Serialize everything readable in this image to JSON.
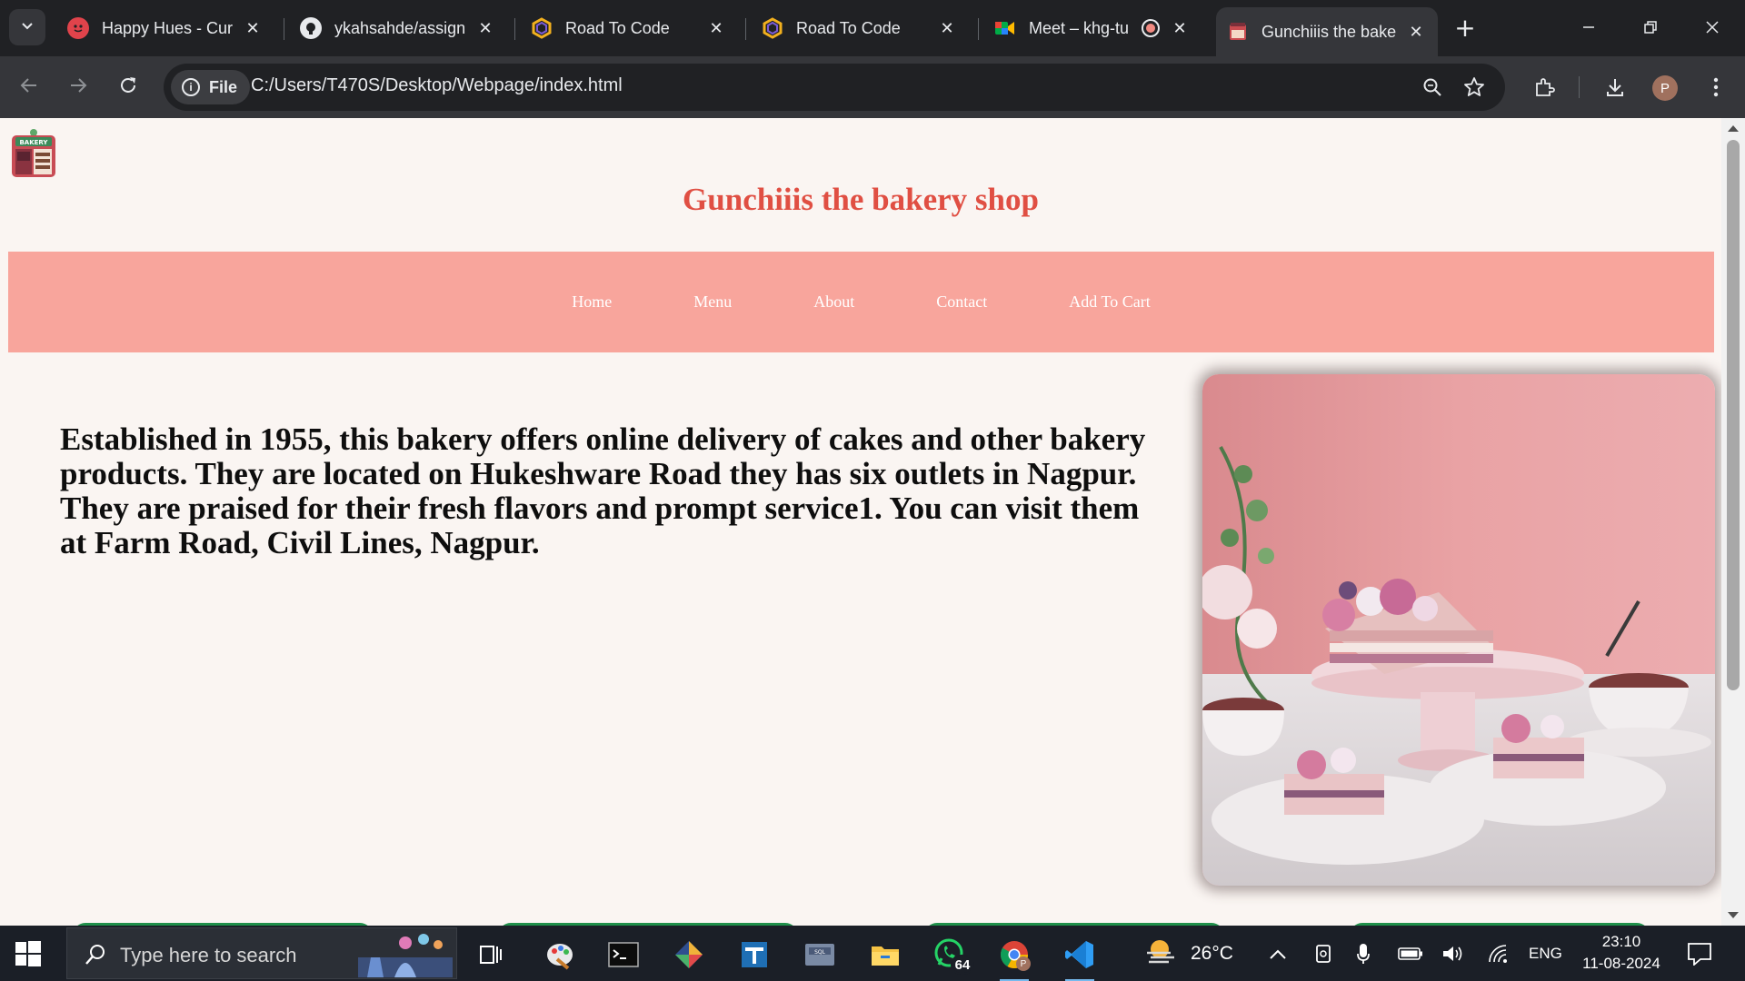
{
  "browser": {
    "tabs": [
      {
        "title": "Happy Hues - Curated colors in context",
        "icon": "happy-hues-icon",
        "active": false
      },
      {
        "title": "ykahsahde/assignment",
        "icon": "github-icon",
        "active": false
      },
      {
        "title": "Road To Code",
        "icon": "road-to-code-icon",
        "active": false
      },
      {
        "title": "Road To Code",
        "icon": "road-to-code-icon",
        "active": false
      },
      {
        "title": "Meet – khg-tu",
        "icon": "google-meet-icon",
        "active": false
      },
      {
        "title": "Gunchiiis the bakery shop",
        "icon": "bakery-icon",
        "active": true
      }
    ],
    "address": {
      "chip_label": "File",
      "url": "C:/Users/T470S/Desktop/Webpage/index.html"
    },
    "profile_initial": "P"
  },
  "page": {
    "title": "Gunchiiis the bakery shop",
    "nav": [
      "Home",
      "Menu",
      "About",
      "Contact",
      "Add To Cart"
    ],
    "intro": "Established in 1955, this bakery offers online delivery of cakes and other bakery products. They are located on Hukeshware Road they has six outlets in Nagpur. They are praised for their fresh flavors and prompt service1. You can visit them at Farm Road, Civil Lines, Nagpur.",
    "logo_text": "BAKERY",
    "colors": {
      "title": "#e04f43",
      "nav_bg": "#f8a59c",
      "nav_text": "#ffffff",
      "page_bg": "#faf5f2",
      "card_accent": "#1f8f4a"
    }
  },
  "taskbar": {
    "search_placeholder": "Type here to search",
    "whatsapp_badge": "64",
    "weather": "26°C",
    "language": "ENG",
    "time": "23:10",
    "date": "11-08-2024"
  }
}
